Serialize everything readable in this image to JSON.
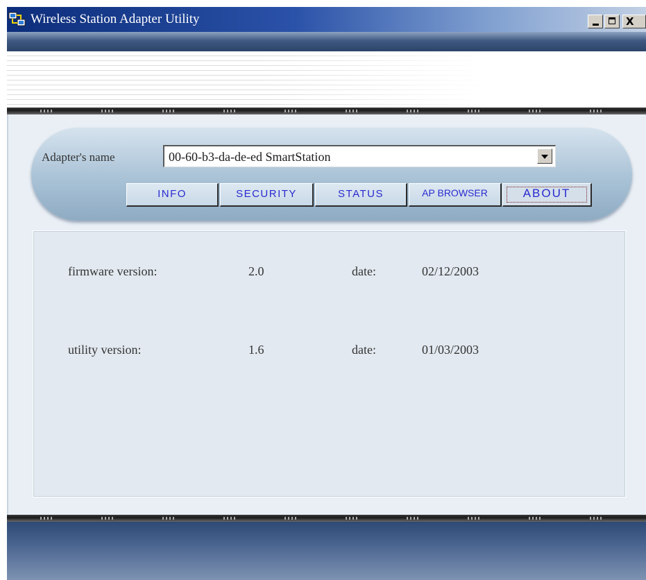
{
  "window": {
    "title": "Wireless Station Adapter Utility",
    "controls": {
      "close_label": "X"
    }
  },
  "adapter": {
    "label": "Adapter's name",
    "selected": "00-60-b3-da-de-ed  SmartStation"
  },
  "tabs": [
    {
      "label": "INFO"
    },
    {
      "label": "SECURITY"
    },
    {
      "label": "STATUS"
    },
    {
      "label": "AP BROWSER"
    },
    {
      "label": "ABOUT",
      "active": true
    }
  ],
  "about": {
    "firmware": {
      "label": "firmware version:",
      "version": "2.0",
      "date_label": "date:",
      "date": "02/12/2003"
    },
    "utility": {
      "label": "utility version:",
      "version": "1.6",
      "date_label": "date:",
      "date": "01/03/2003"
    }
  },
  "colors": {
    "titlebar_start": "#0c2d7a",
    "tab_text": "#2a2ad0",
    "panel_bg": "#e2e9f0"
  }
}
